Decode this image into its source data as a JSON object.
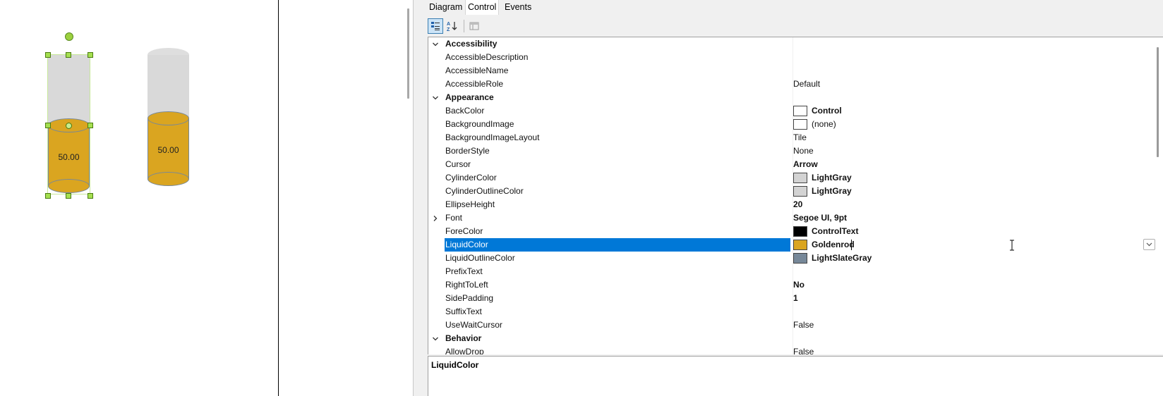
{
  "canvas": {
    "cylinders": [
      {
        "value": "50.00",
        "selected": true
      },
      {
        "value": "50.00",
        "selected": false
      }
    ]
  },
  "property_grid": {
    "tabs": [
      {
        "label": "Diagram",
        "active": false
      },
      {
        "label": "Control",
        "active": true
      },
      {
        "label": "Events",
        "active": false
      }
    ],
    "toolbar": [
      "categorized-icon",
      "alphabetical-sort-icon",
      "property-pages-icon"
    ],
    "rows": [
      {
        "type": "category",
        "name": "Accessibility",
        "expanded": true
      },
      {
        "type": "prop",
        "name": "AccessibleDescription",
        "value": ""
      },
      {
        "type": "prop",
        "name": "AccessibleName",
        "value": ""
      },
      {
        "type": "prop",
        "name": "AccessibleRole",
        "value": "Default"
      },
      {
        "type": "category",
        "name": "Appearance",
        "expanded": true
      },
      {
        "type": "prop",
        "name": "BackColor",
        "value": "Control",
        "bold": true,
        "swatch": "#ffffff"
      },
      {
        "type": "prop",
        "name": "BackgroundImage",
        "value": "(none)",
        "swatch": "#ffffff"
      },
      {
        "type": "prop",
        "name": "BackgroundImageLayout",
        "value": "Tile"
      },
      {
        "type": "prop",
        "name": "BorderStyle",
        "value": "None"
      },
      {
        "type": "prop",
        "name": "Cursor",
        "value": "Arrow",
        "bold": true
      },
      {
        "type": "prop",
        "name": "CylinderColor",
        "value": "LightGray",
        "bold": true,
        "swatch": "#d3d3d3"
      },
      {
        "type": "prop",
        "name": "CylinderOutlineColor",
        "value": "LightGray",
        "bold": true,
        "swatch": "#d3d3d3"
      },
      {
        "type": "prop",
        "name": "EllipseHeight",
        "value": "20",
        "bold": true
      },
      {
        "type": "prop",
        "name": "Font",
        "value": "Segoe UI, 9pt",
        "bold": true,
        "expandable": true
      },
      {
        "type": "prop",
        "name": "ForeColor",
        "value": "ControlText",
        "bold": true,
        "swatch": "#000000"
      },
      {
        "type": "prop",
        "name": "LiquidColor",
        "value": "Goldenrod",
        "bold": true,
        "swatch": "#daa520",
        "selected": true
      },
      {
        "type": "prop",
        "name": "LiquidOutlineColor",
        "value": "LightSlateGray",
        "bold": true,
        "swatch": "#778899"
      },
      {
        "type": "prop",
        "name": "PrefixText",
        "value": ""
      },
      {
        "type": "prop",
        "name": "RightToLeft",
        "value": "No",
        "bold": true
      },
      {
        "type": "prop",
        "name": "SidePadding",
        "value": "1",
        "bold": true
      },
      {
        "type": "prop",
        "name": "SuffixText",
        "value": ""
      },
      {
        "type": "prop",
        "name": "UseWaitCursor",
        "value": "False"
      },
      {
        "type": "category",
        "name": "Behavior",
        "expanded": true
      },
      {
        "type": "prop",
        "name": "AllowDrop",
        "value": "False"
      }
    ],
    "description": {
      "title": "LiquidColor"
    }
  },
  "colors": {
    "selection": "#0078d7",
    "liquid": "#daa520",
    "liquid_outline": "#778899",
    "cylinder": "#d3d3d3",
    "handle": "#a5e050"
  }
}
